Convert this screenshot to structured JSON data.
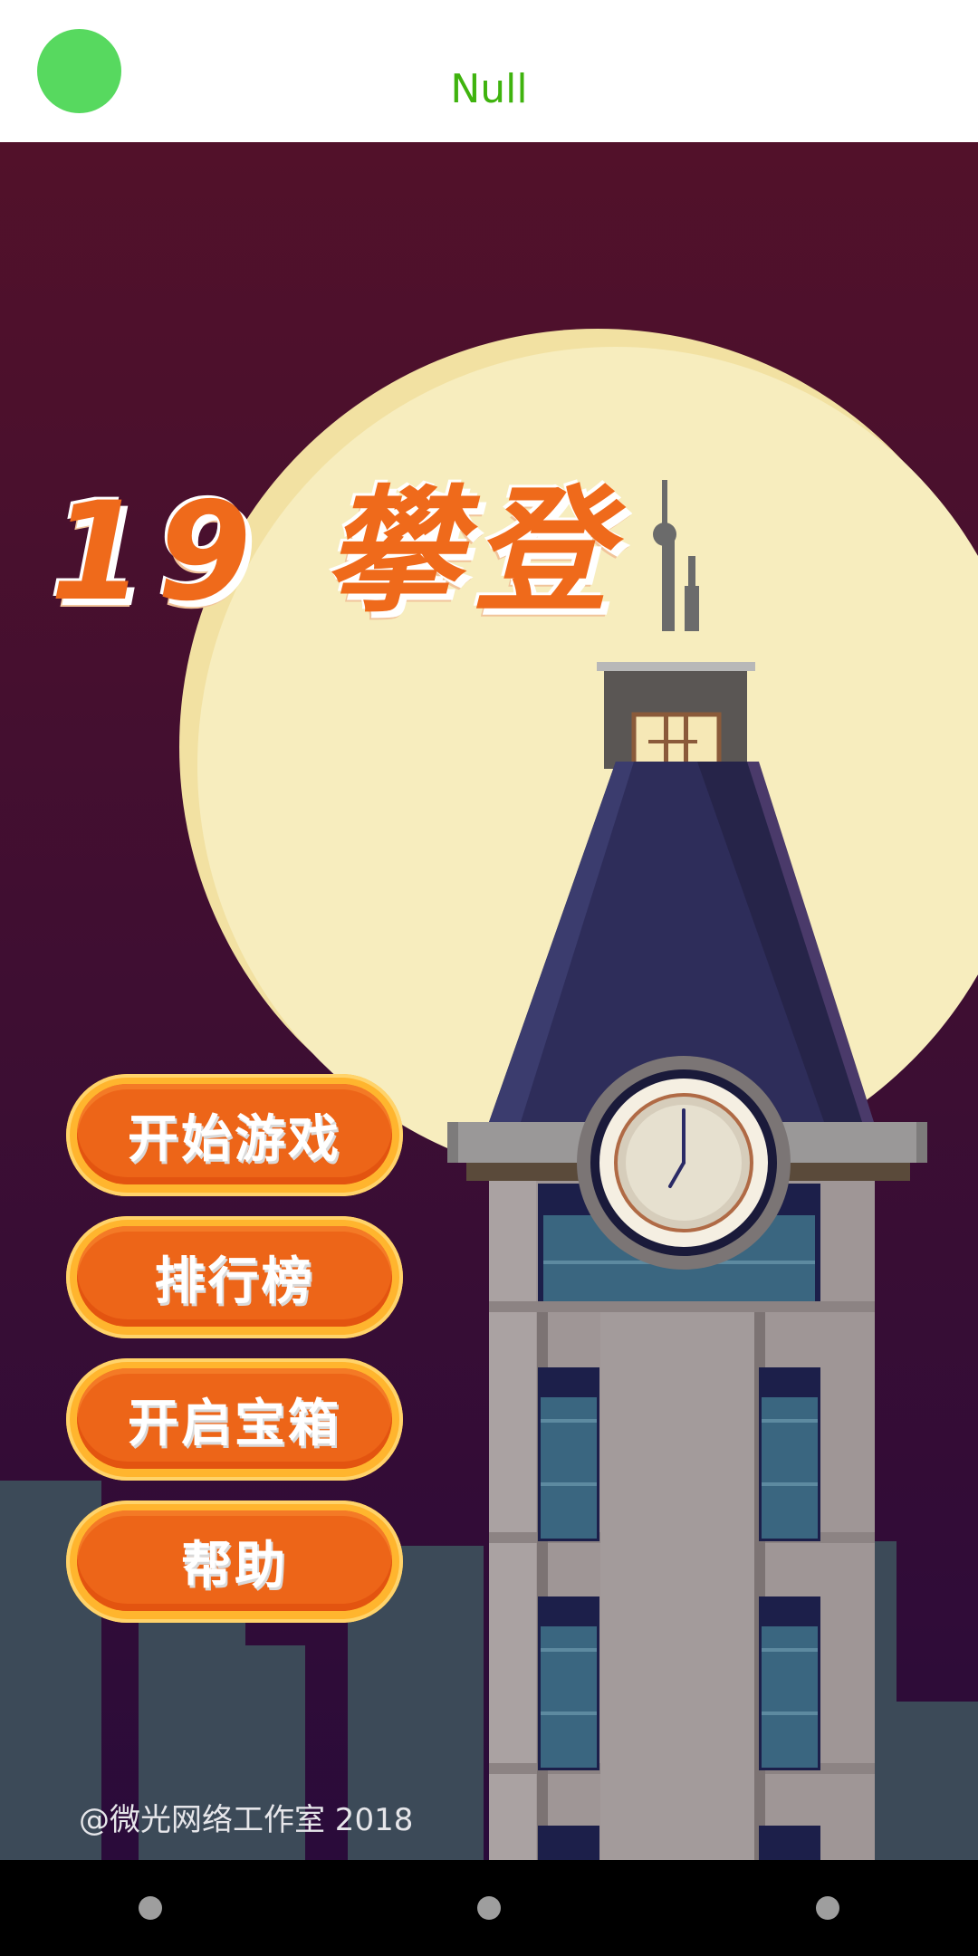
{
  "header": {
    "title": "Null",
    "title_color": "#3fb30e",
    "status_dot_color": "#57d95f"
  },
  "game": {
    "title": "19 攀登",
    "title_color": "#ef6a1b"
  },
  "menu": {
    "items": [
      {
        "label": "开始游戏"
      },
      {
        "label": "排行榜"
      },
      {
        "label": "开启宝箱"
      },
      {
        "label": "帮助"
      }
    ]
  },
  "footer": {
    "credit": "@微光网络工作室 2018"
  },
  "scene": {
    "sky_top": "#52112a",
    "sky_bottom": "#2a0b3a",
    "moon_color": "#f7edbe",
    "moon_rim": "#f2e1a2",
    "clock_time": "7:00"
  },
  "navbar": {
    "buttons": [
      "back-icon",
      "home-icon",
      "recents-icon"
    ]
  }
}
